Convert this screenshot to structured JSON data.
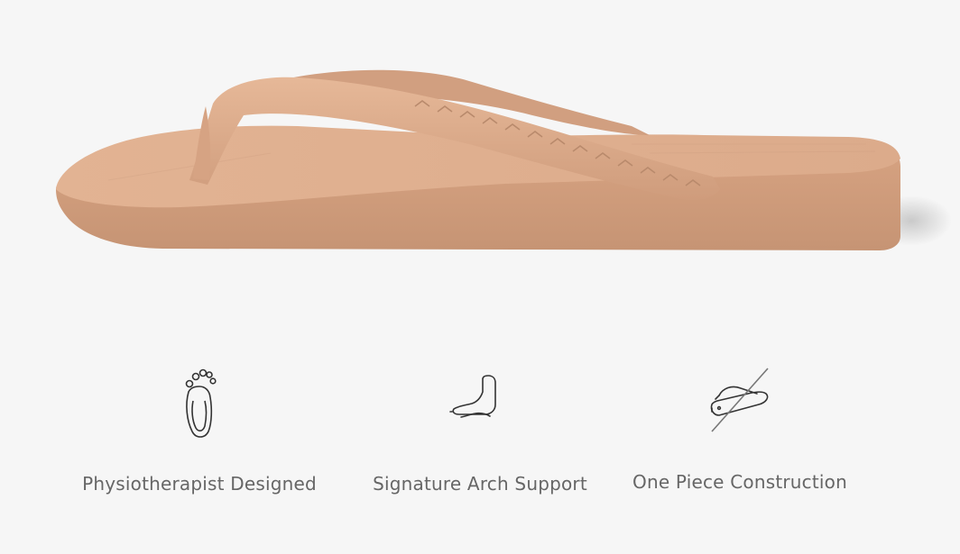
{
  "features": [
    {
      "label": "Physiotherapist Designed",
      "icon": "footprint-icon"
    },
    {
      "label": "Signature Arch Support",
      "icon": "foot-arch-icon"
    },
    {
      "label": "One Piece Construction",
      "icon": "sandal-no-strap-joint-icon"
    }
  ],
  "colors": {
    "background": "#f6f6f6",
    "product": "#d9a786",
    "text": "#666666",
    "icon_stroke": "#333333"
  }
}
